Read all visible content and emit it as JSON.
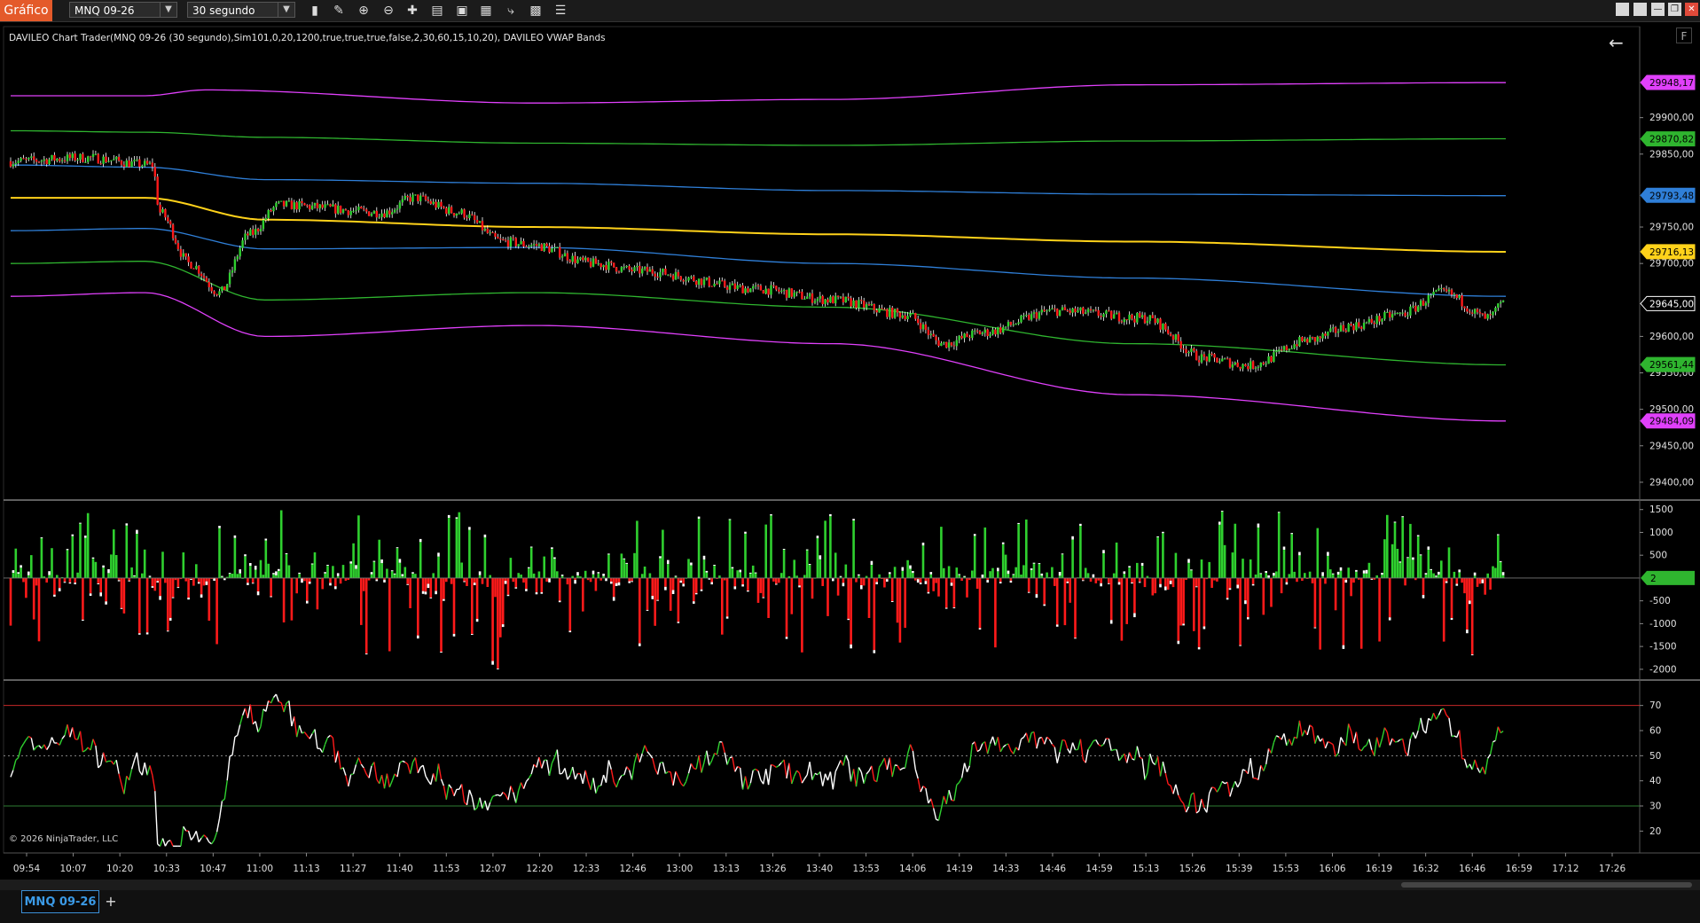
{
  "toolbar": {
    "title": "Gráfico",
    "instrument": "MNQ 09-26",
    "interval": "30 segundo",
    "tools": [
      "bars-icon",
      "pencil-icon",
      "zoom-in-icon",
      "zoom-out-icon",
      "crosshair-icon",
      "data-box-icon",
      "drawing-objects-icon",
      "template-icon",
      "strategies-icon",
      "indicators-icon",
      "properties-icon"
    ]
  },
  "window_buttons": [
    "minimize",
    "maximize",
    "restore",
    "close"
  ],
  "chart": {
    "header_text": "DAVILEO Chart Trader(MNQ 09-26 (30 segundo),Sim101,0,20,1200,true,true,true,false,2,30,60,15,10,20), DAVILEO VWAP Bands",
    "copyright": "© 2026 NinjaTrader, LLC",
    "f_button": "F",
    "back_arrow": "←"
  },
  "colors": {
    "magenta": "#e040fb",
    "green": "#2fb52f",
    "blue": "#2f7fd8",
    "yellow": "#ffd21a",
    "up": "#2fd02f",
    "down": "#ff1a1a",
    "white": "#ffffff",
    "rsi_high": "#c62828",
    "rsi_low": "#2e7d32"
  },
  "chart_data": {
    "type": "candlestick",
    "price_axis_ticks": [
      29900,
      29850,
      29750,
      29700,
      29600,
      29550,
      29500,
      29450,
      29400
    ],
    "price_axis_labels": [
      "29900,00",
      "29850,00",
      "29750,00",
      "29700,00",
      "29600,00",
      "29550,00",
      "29500,00",
      "29450,00",
      "29400,00"
    ],
    "price_ylim": [
      29378,
      29992
    ],
    "badges": [
      {
        "label": "29948,17",
        "value": 29948.17,
        "color": "#e040fb"
      },
      {
        "label": "29870,82",
        "value": 29870.82,
        "color": "#2fb52f"
      },
      {
        "label": "29793,48",
        "value": 29793.48,
        "color": "#2f7fd8"
      },
      {
        "label": "29716,13",
        "value": 29716.13,
        "color": "#ffd21a"
      },
      {
        "label": "29645,00",
        "value": 29645.0,
        "color": "#000000"
      },
      {
        "label": "29561,44",
        "value": 29561.44,
        "color": "#2fb52f"
      },
      {
        "label": "29484,09",
        "value": 29484.09,
        "color": "#e040fb"
      }
    ],
    "vwap_bands": {
      "vwap": [
        [
          0,
          29790
        ],
        [
          0.09,
          29790
        ],
        [
          0.17,
          29760
        ],
        [
          0.35,
          29750
        ],
        [
          0.55,
          29740
        ],
        [
          0.75,
          29730
        ],
        [
          1,
          29716
        ]
      ],
      "upper1": [
        [
          0,
          29745
        ],
        [
          0.09,
          29748
        ],
        [
          0.17,
          29720
        ],
        [
          0.35,
          29722
        ],
        [
          0.55,
          29700
        ],
        [
          0.75,
          29680
        ],
        [
          1,
          29655
        ]
      ],
      "lower1": [
        [
          0,
          29835
        ],
        [
          0.09,
          29832
        ],
        [
          0.17,
          29815
        ],
        [
          0.35,
          29810
        ],
        [
          0.55,
          29800
        ],
        [
          0.75,
          29795
        ],
        [
          1,
          29793
        ]
      ],
      "upper2": [
        [
          0,
          29700
        ],
        [
          0.09,
          29703
        ],
        [
          0.17,
          29650
        ],
        [
          0.35,
          29660
        ],
        [
          0.55,
          29640
        ],
        [
          0.75,
          29590
        ],
        [
          1,
          29561
        ]
      ],
      "lower2": [
        [
          0,
          29882
        ],
        [
          0.09,
          29880
        ],
        [
          0.17,
          29873
        ],
        [
          0.35,
          29865
        ],
        [
          0.55,
          29862
        ],
        [
          0.75,
          29868
        ],
        [
          1,
          29871
        ]
      ],
      "upper3": [
        [
          0,
          29655
        ],
        [
          0.09,
          29660
        ],
        [
          0.17,
          29600
        ],
        [
          0.35,
          29615
        ],
        [
          0.55,
          29590
        ],
        [
          0.75,
          29520
        ],
        [
          1,
          29484
        ]
      ],
      "lower3": [
        [
          0,
          29930
        ],
        [
          0.09,
          29930
        ],
        [
          0.13,
          29938
        ],
        [
          0.35,
          29920
        ],
        [
          0.55,
          29925
        ],
        [
          0.75,
          29945
        ],
        [
          1,
          29948
        ]
      ]
    },
    "price_path": [
      [
        0,
        29840
      ],
      [
        0.05,
        29845
      ],
      [
        0.095,
        29835
      ],
      [
        0.1,
        29770
      ],
      [
        0.12,
        29700
      ],
      [
        0.14,
        29660
      ],
      [
        0.16,
        29740
      ],
      [
        0.18,
        29780
      ],
      [
        0.25,
        29770
      ],
      [
        0.27,
        29790
      ],
      [
        0.3,
        29770
      ],
      [
        0.33,
        29730
      ],
      [
        0.35,
        29725
      ],
      [
        0.39,
        29700
      ],
      [
        0.42,
        29690
      ],
      [
        0.5,
        29665
      ],
      [
        0.55,
        29650
      ],
      [
        0.6,
        29630
      ],
      [
        0.625,
        29590
      ],
      [
        0.65,
        29605
      ],
      [
        0.7,
        29635
      ],
      [
        0.76,
        29625
      ],
      [
        0.8,
        29570
      ],
      [
        0.83,
        29560
      ],
      [
        0.87,
        29595
      ],
      [
        0.9,
        29615
      ],
      [
        0.93,
        29630
      ],
      [
        0.96,
        29660
      ],
      [
        0.99,
        29625
      ],
      [
        1,
        29645
      ]
    ],
    "volume_delta_axis_labels": [
      "1500",
      "1000",
      "500",
      "-500",
      "-1000",
      "-1500",
      "-2000"
    ],
    "volume_delta_ticks": [
      1500,
      1000,
      500,
      -500,
      -1000,
      -1500,
      -2000
    ],
    "volume_delta_ylim": [
      -2100,
      1650
    ],
    "volume_delta_last": {
      "label": "2",
      "value": 2
    },
    "rsi_axis_labels": [
      "70",
      "60",
      "50",
      "40",
      "30",
      "20"
    ],
    "rsi_ticks": [
      70,
      60,
      50,
      40,
      30,
      20
    ],
    "rsi_levels": {
      "overbought": 70,
      "mid": 50,
      "oversold": 30
    },
    "rsi_ylim": [
      12,
      78
    ],
    "time_labels": [
      "09:54",
      "10:07",
      "10:20",
      "10:33",
      "10:47",
      "11:00",
      "11:13",
      "11:27",
      "11:40",
      "11:53",
      "12:07",
      "12:20",
      "12:33",
      "12:46",
      "13:00",
      "13:13",
      "13:26",
      "13:40",
      "13:53",
      "14:06",
      "14:19",
      "14:33",
      "14:46",
      "14:59",
      "15:13",
      "15:26",
      "15:39",
      "15:53",
      "16:06",
      "16:19",
      "16:32",
      "16:46",
      "16:59",
      "17:12",
      "17:26"
    ]
  },
  "tabs": {
    "active": "MNQ 09-26",
    "add": "+"
  }
}
